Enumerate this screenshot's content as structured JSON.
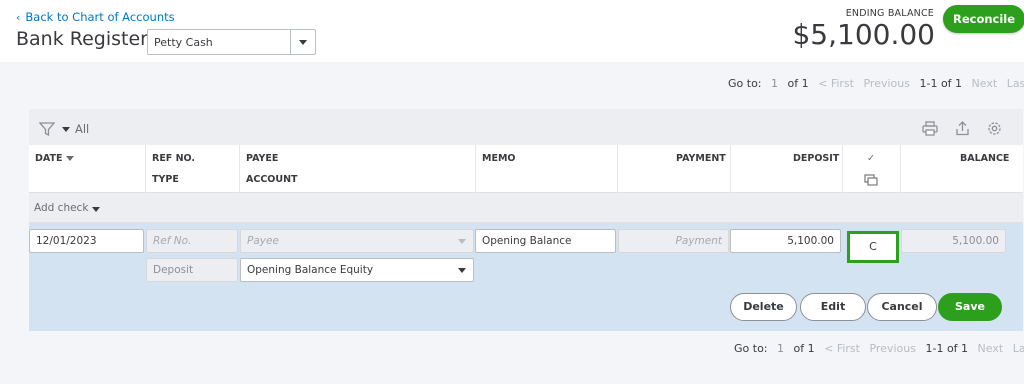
{
  "header": {
    "back_link": "Back to Chart of Accounts",
    "title": "Bank Register",
    "account_select": "Petty Cash",
    "ending_balance_label": "ENDING BALANCE",
    "ending_balance": "$5,100.00",
    "reconcile_label": "Reconcile"
  },
  "pager_top": {
    "goto": "Go to:",
    "page": "1",
    "of": "of 1",
    "first": "< First",
    "previous": "Previous",
    "range": "1-1 of 1",
    "next": "Next",
    "last": "Last >"
  },
  "toolbar": {
    "filter_label": "All",
    "icons": [
      "filter-icon",
      "print-icon",
      "export-icon",
      "gear-icon"
    ]
  },
  "columns": {
    "date": "DATE",
    "ref_no": "REF NO.",
    "type": "TYPE",
    "payee": "PAYEE",
    "account": "ACCOUNT",
    "memo": "MEMO",
    "payment": "PAYMENT",
    "deposit": "DEPOSIT",
    "check_mark": "✓",
    "balance": "BALANCE"
  },
  "add_check": "Add check",
  "edit_row": {
    "date": "12/01/2023",
    "ref_no_placeholder": "Ref No.",
    "payee_placeholder": "Payee",
    "memo": "Opening Balance",
    "payment_placeholder": "Payment",
    "deposit": "5,100.00",
    "reconcile_status": "C",
    "balance": "5,100.00",
    "type": "Deposit",
    "account": "Opening Balance Equity"
  },
  "actions": {
    "delete": "Delete",
    "edit": "Edit",
    "cancel": "Cancel",
    "save": "Save"
  },
  "pager_bottom": {
    "goto": "Go to:",
    "page": "1",
    "of": "of 1",
    "first": "< First",
    "previous": "Previous",
    "range": "1-1 of 1",
    "next": "Next",
    "last": "Last >"
  },
  "colors": {
    "link": "#0077c5",
    "primary_green": "#2ca01c",
    "edit_row_bg": "#d4e3f2"
  }
}
